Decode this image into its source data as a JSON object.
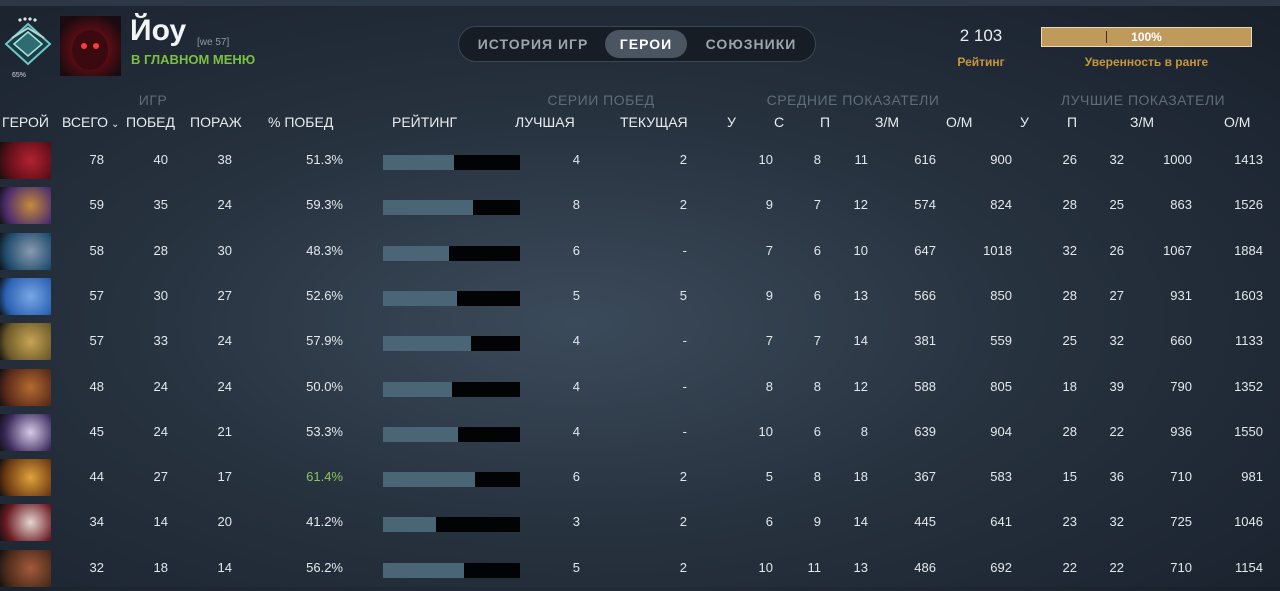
{
  "player": {
    "name": "Йоу",
    "tag": "[we 57]",
    "status": "В ГЛАВНОМ МЕНЮ",
    "medal_pct": "65%"
  },
  "tabs": [
    {
      "label": "ИСТОРИЯ ИГР",
      "active": false
    },
    {
      "label": "ГЕРОИ",
      "active": true
    },
    {
      "label": "СОЮЗНИКИ",
      "active": false
    }
  ],
  "summary": {
    "rating_value": "2 103",
    "rating_label": "Рейтинг",
    "confidence_value": "100%",
    "confidence_label": "Уверенность в ранге"
  },
  "groups": {
    "games": "ИГР",
    "streaks": "СЕРИИ ПОБЕД",
    "averages": "СРЕДНИЕ ПОКАЗАТЕЛИ",
    "best": "ЛУЧШИЕ ПОКАЗАТЕЛИ"
  },
  "columns": {
    "hero": "ГЕРОЙ",
    "total": "ВСЕГО",
    "wins": "ПОБЕД",
    "losses": "ПОРАЖ",
    "winrate": "% ПОБЕД",
    "rating": "РЕЙТИНГ",
    "best_streak": "ЛУЧШАЯ",
    "current_streak": "ТЕКУЩАЯ",
    "avg_k": "У",
    "avg_d": "С",
    "avg_a": "П",
    "avg_gpm": "З/М",
    "avg_xpm": "О/М",
    "best_k": "У",
    "best_a": "П",
    "best_gpm": "З/М",
    "best_xpm": "О/М"
  },
  "rows": [
    {
      "total": "78",
      "wins": "40",
      "losses": "38",
      "winrate": "51.3%",
      "rating_fill": 0.52,
      "best": "4",
      "current": "2",
      "ak": "10",
      "ad": "8",
      "aa": "11",
      "agpm": "616",
      "axpm": "900",
      "bk": "26",
      "ba": "32",
      "bgpm": "1000",
      "bxpm": "1413",
      "hero_colors": [
        "#5b0e18",
        "#b32231"
      ]
    },
    {
      "total": "59",
      "wins": "35",
      "losses": "24",
      "winrate": "59.3%",
      "rating_fill": 0.66,
      "best": "8",
      "current": "2",
      "ak": "9",
      "ad": "7",
      "aa": "12",
      "agpm": "574",
      "axpm": "824",
      "bk": "28",
      "ba": "25",
      "bgpm": "863",
      "bxpm": "1526",
      "hero_colors": [
        "#4c2d6e",
        "#c58a3a"
      ]
    },
    {
      "total": "58",
      "wins": "28",
      "losses": "30",
      "winrate": "48.3%",
      "rating_fill": 0.48,
      "best": "6",
      "current": "-",
      "ak": "7",
      "ad": "6",
      "aa": "10",
      "agpm": "647",
      "axpm": "1018",
      "bk": "32",
      "ba": "26",
      "bgpm": "1067",
      "bxpm": "1884",
      "hero_colors": [
        "#1f4c6e",
        "#8a9ab0"
      ]
    },
    {
      "total": "57",
      "wins": "30",
      "losses": "27",
      "winrate": "52.6%",
      "rating_fill": 0.54,
      "best": "5",
      "current": "5",
      "ak": "9",
      "ad": "6",
      "aa": "13",
      "agpm": "566",
      "axpm": "850",
      "bk": "28",
      "ba": "27",
      "bgpm": "931",
      "bxpm": "1603",
      "hero_colors": [
        "#2a62b3",
        "#7aa6e6"
      ]
    },
    {
      "total": "57",
      "wins": "33",
      "losses": "24",
      "winrate": "57.9%",
      "rating_fill": 0.64,
      "best": "4",
      "current": "-",
      "ak": "7",
      "ad": "7",
      "aa": "14",
      "agpm": "381",
      "axpm": "559",
      "bk": "25",
      "ba": "32",
      "bgpm": "660",
      "bxpm": "1133",
      "hero_colors": [
        "#6b5a2a",
        "#c9a454"
      ]
    },
    {
      "total": "48",
      "wins": "24",
      "losses": "24",
      "winrate": "50.0%",
      "rating_fill": 0.5,
      "best": "4",
      "current": "-",
      "ak": "8",
      "ad": "8",
      "aa": "12",
      "agpm": "588",
      "axpm": "805",
      "bk": "18",
      "ba": "39",
      "bgpm": "790",
      "bxpm": "1352",
      "hero_colors": [
        "#5a2a1a",
        "#b36a2e"
      ]
    },
    {
      "total": "45",
      "wins": "24",
      "losses": "21",
      "winrate": "53.3%",
      "rating_fill": 0.55,
      "best": "4",
      "current": "-",
      "ak": "10",
      "ad": "6",
      "aa": "8",
      "agpm": "639",
      "axpm": "904",
      "bk": "28",
      "ba": "22",
      "bgpm": "936",
      "bxpm": "1550",
      "hero_colors": [
        "#3b2a5c",
        "#d7c9e8"
      ]
    },
    {
      "total": "44",
      "wins": "27",
      "losses": "17",
      "winrate": "61.4%",
      "rating_fill": 0.67,
      "best": "6",
      "current": "2",
      "ak": "5",
      "ad": "8",
      "aa": "18",
      "agpm": "367",
      "axpm": "583",
      "bk": "15",
      "ba": "36",
      "bgpm": "710",
      "bxpm": "981",
      "hero_colors": [
        "#6e3a12",
        "#e0a23c"
      ]
    },
    {
      "total": "34",
      "wins": "14",
      "losses": "20",
      "winrate": "41.2%",
      "rating_fill": 0.39,
      "best": "3",
      "current": "2",
      "ak": "6",
      "ad": "9",
      "aa": "14",
      "agpm": "445",
      "axpm": "641",
      "bk": "23",
      "ba": "32",
      "bgpm": "725",
      "bxpm": "1046",
      "hero_colors": [
        "#6a1a22",
        "#e6d6d0"
      ]
    },
    {
      "total": "32",
      "wins": "18",
      "losses": "14",
      "winrate": "56.2%",
      "rating_fill": 0.59,
      "best": "5",
      "current": "2",
      "ak": "10",
      "ad": "11",
      "aa": "13",
      "agpm": "486",
      "axpm": "692",
      "bk": "22",
      "ba": "22",
      "bgpm": "710",
      "bxpm": "1154",
      "hero_colors": [
        "#4a2a1a",
        "#a35a3a"
      ]
    }
  ]
}
